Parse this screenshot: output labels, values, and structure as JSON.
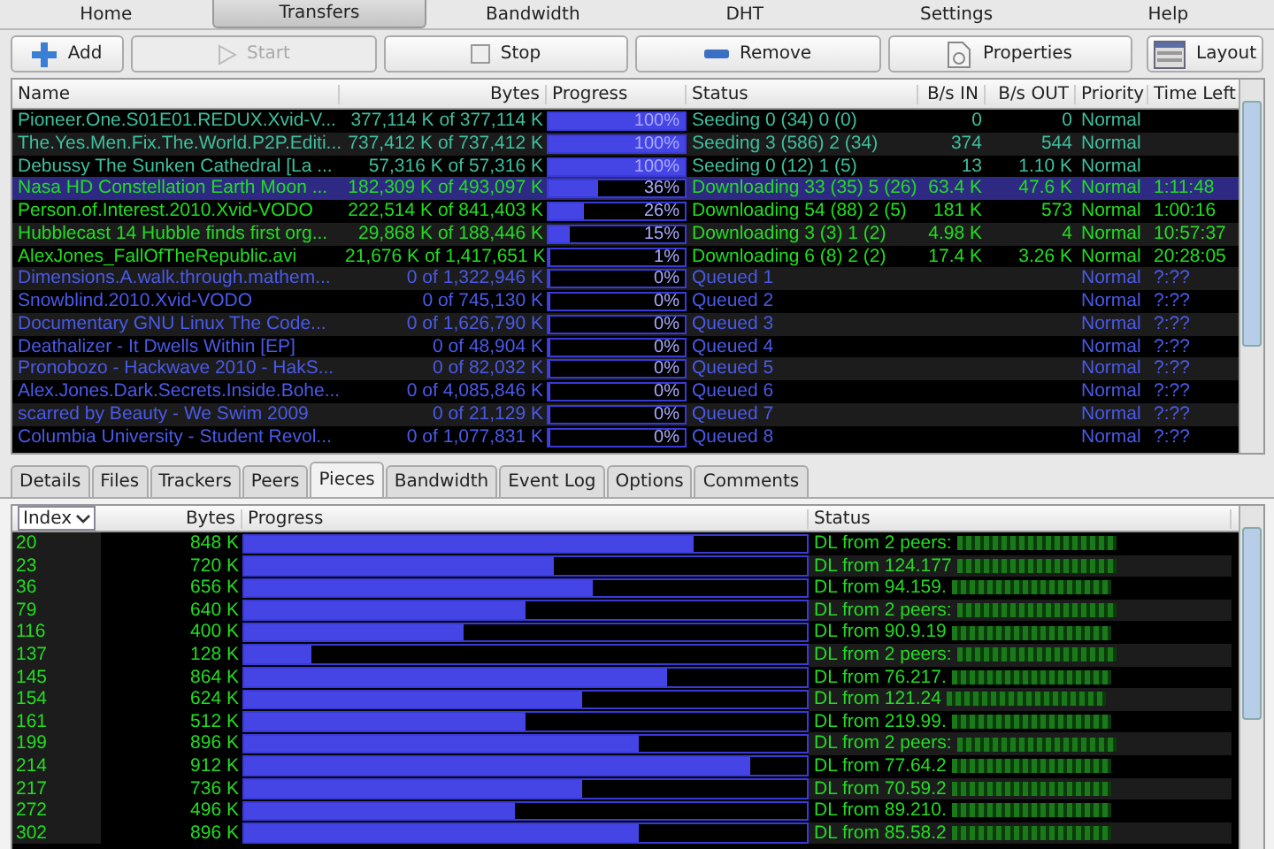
{
  "menu_tabs": [
    {
      "label": "Home",
      "selected": false
    },
    {
      "label": "Transfers",
      "selected": true
    },
    {
      "label": "Bandwidth",
      "selected": false
    },
    {
      "label": "DHT",
      "selected": false
    },
    {
      "label": "Settings",
      "selected": false
    },
    {
      "label": "Help",
      "selected": false
    }
  ],
  "toolbar": [
    {
      "kind": "add",
      "label": "Add",
      "disabled": false
    },
    {
      "kind": "start",
      "label": "Start",
      "disabled": true
    },
    {
      "kind": "stop",
      "label": "Stop",
      "disabled": false
    },
    {
      "kind": "remove",
      "label": "Remove",
      "disabled": false
    },
    {
      "kind": "properties",
      "label": "Properties",
      "disabled": false
    },
    {
      "kind": "layout",
      "label": "Layout",
      "disabled": false
    }
  ],
  "transfers": {
    "columns": [
      "Name",
      "Bytes",
      "Progress",
      "Status",
      "B/s IN",
      "B/s OUT",
      "Priority",
      "Time Left"
    ],
    "rows": [
      {
        "kind": "seeding",
        "selected": false,
        "name": "Pioneer.One.S01E01.REDUX.Xvid-V...",
        "bytes": "377,114 K of 377,114 K",
        "progress": "100%",
        "level": 1,
        "status": "Seeding 0 (34) 0 (0)",
        "in": "0",
        "out": "0",
        "priority": "Normal",
        "time_left": ""
      },
      {
        "kind": "seeding",
        "selected": false,
        "name": "The.Yes.Men.Fix.The.World.P2P.Editi...",
        "bytes": "737,412 K of 737,412 K",
        "progress": "100%",
        "level": 1,
        "status": "Seeding 3 (586) 2 (34)",
        "in": "374",
        "out": "544",
        "priority": "Normal",
        "time_left": ""
      },
      {
        "kind": "seeding",
        "selected": false,
        "name": "Debussy The Sunken Cathedral [La ...",
        "bytes": "57,316 K of 57,316 K",
        "progress": "100%",
        "level": 1,
        "status": "Seeding 0 (12) 1 (5)",
        "in": "13",
        "out": "1.10 K",
        "priority": "Normal",
        "time_left": ""
      },
      {
        "kind": "downloading",
        "selected": true,
        "name": "Nasa HD Constellation Earth Moon ...",
        "bytes": "182,309 K of 493,097 K",
        "progress": "36%",
        "level": 0.36,
        "status": "Downloading 33 (35) 5 (26)",
        "in": "63.4 K",
        "out": "47.6 K",
        "priority": "Normal",
        "time_left": "1:11:48"
      },
      {
        "kind": "downloading",
        "selected": false,
        "name": "Person.of.Interest.2010.Xvid-VODO",
        "bytes": "222,514 K of 841,403 K",
        "progress": "26%",
        "level": 0.26,
        "status": "Downloading 54 (88) 2 (5)",
        "in": "181 K",
        "out": "573",
        "priority": "Normal",
        "time_left": "1:00:16"
      },
      {
        "kind": "downloading",
        "selected": false,
        "name": "Hubblecast 14 Hubble finds first org...",
        "bytes": "29,868 K of 188,446 K",
        "progress": "15%",
        "level": 0.15,
        "status": "Downloading 3 (3) 1 (2)",
        "in": "4.98 K",
        "out": "4",
        "priority": "Normal",
        "time_left": "10:57:37"
      },
      {
        "kind": "downloading",
        "selected": false,
        "name": "AlexJones_FallOfTheRepublic.avi",
        "bytes": "21,676 K of 1,417,651 K",
        "progress": "1%",
        "level": 0.01,
        "status": "Downloading 6 (8) 2 (2)",
        "in": "17.4 K",
        "out": "3.26 K",
        "priority": "Normal",
        "time_left": "20:28:05"
      },
      {
        "kind": "queued",
        "selected": false,
        "name": "Dimensions.A.walk.through.mathem...",
        "bytes": "0 of 1,322,946 K",
        "progress": "0%",
        "level": 0,
        "status": "Queued 1",
        "in": "",
        "out": "",
        "priority": "Normal",
        "time_left": "?:??"
      },
      {
        "kind": "queued",
        "selected": false,
        "name": "Snowblind.2010.Xvid-VODO",
        "bytes": "0 of 745,130 K",
        "progress": "0%",
        "level": 0,
        "status": "Queued 2",
        "in": "",
        "out": "",
        "priority": "Normal",
        "time_left": "?:??"
      },
      {
        "kind": "queued",
        "selected": false,
        "name": "Documentary  GNU  Linux  The Code...",
        "bytes": "0 of 1,626,790 K",
        "progress": "0%",
        "level": 0,
        "status": "Queued 3",
        "in": "",
        "out": "",
        "priority": "Normal",
        "time_left": "?:??"
      },
      {
        "kind": "queued",
        "selected": false,
        "name": "Deathalizer - It Dwells Within [EP]",
        "bytes": "0 of 48,904 K",
        "progress": "0%",
        "level": 0,
        "status": "Queued 4",
        "in": "",
        "out": "",
        "priority": "Normal",
        "time_left": "?:??"
      },
      {
        "kind": "queued",
        "selected": false,
        "name": "Pronobozo - Hackwave 2010 - HakS...",
        "bytes": "0 of 82,032 K",
        "progress": "0%",
        "level": 0,
        "status": "Queued 5",
        "in": "",
        "out": "",
        "priority": "Normal",
        "time_left": "?:??"
      },
      {
        "kind": "queued",
        "selected": false,
        "name": "Alex.Jones.Dark.Secrets.Inside.Bohe...",
        "bytes": "0 of 4,085,846 K",
        "progress": "0%",
        "level": 0,
        "status": "Queued 6",
        "in": "",
        "out": "",
        "priority": "Normal",
        "time_left": "?:??"
      },
      {
        "kind": "queued",
        "selected": false,
        "name": "scarred by Beauty - We Swim 2009",
        "bytes": "0 of 21,129 K",
        "progress": "0%",
        "level": 0,
        "status": "Queued 7",
        "in": "",
        "out": "",
        "priority": "Normal",
        "time_left": "?:??"
      },
      {
        "kind": "queued",
        "selected": false,
        "name": "Columbia University - Student Revol...",
        "bytes": "0 of 1,077,831 K",
        "progress": "0%",
        "level": 0,
        "status": "Queued 8",
        "in": "",
        "out": "",
        "priority": "Normal",
        "time_left": "?:??"
      }
    ]
  },
  "detail_tabs": [
    {
      "label": "Details",
      "selected": false
    },
    {
      "label": "Files",
      "selected": false
    },
    {
      "label": "Trackers",
      "selected": false
    },
    {
      "label": "Peers",
      "selected": false
    },
    {
      "label": "Pieces",
      "selected": true
    },
    {
      "label": "Bandwidth",
      "selected": false
    },
    {
      "label": "Event Log",
      "selected": false
    },
    {
      "label": "Options",
      "selected": false
    },
    {
      "label": "Comments",
      "selected": false
    }
  ],
  "pieces": {
    "sort_select": "Index",
    "columns": [
      "Bytes",
      "Progress",
      "Status"
    ],
    "rows": [
      {
        "index": "20",
        "bytes": "848 K",
        "level": 0.8,
        "status": "DL from 2 peers:",
        "obscured": true
      },
      {
        "index": "23",
        "bytes": "720 K",
        "level": 0.55,
        "status": "DL from 124.177",
        "obscured": true
      },
      {
        "index": "36",
        "bytes": "656 K",
        "level": 0.62,
        "status": "DL from 94.159.",
        "obscured": true
      },
      {
        "index": "79",
        "bytes": "640 K",
        "level": 0.5,
        "status": "DL from 2 peers:",
        "obscured": true
      },
      {
        "index": "116",
        "bytes": "400 K",
        "level": 0.39,
        "status": "DL from 90.9.19",
        "obscured": true
      },
      {
        "index": "137",
        "bytes": "128 K",
        "level": 0.12,
        "status": "DL from 2 peers:",
        "obscured": true
      },
      {
        "index": "145",
        "bytes": "864 K",
        "level": 0.75,
        "status": "DL from 76.217.",
        "obscured": true
      },
      {
        "index": "154",
        "bytes": "624 K",
        "level": 0.6,
        "status": "DL from 121.24",
        "obscured": true
      },
      {
        "index": "161",
        "bytes": "512 K",
        "level": 0.5,
        "status": "DL from 219.99.",
        "obscured": true
      },
      {
        "index": "199",
        "bytes": "896 K",
        "level": 0.7,
        "status": "DL from 2 peers:",
        "obscured": true
      },
      {
        "index": "214",
        "bytes": "912 K",
        "level": 0.9,
        "status": "DL from 77.64.2",
        "obscured": true
      },
      {
        "index": "217",
        "bytes": "736 K",
        "level": 0.6,
        "status": "DL from 70.59.2",
        "obscured": true
      },
      {
        "index": "272",
        "bytes": "496 K",
        "level": 0.48,
        "status": "DL from 89.210.",
        "obscured": true
      },
      {
        "index": "302",
        "bytes": "896 K",
        "level": 0.7,
        "status": "DL from 85.58.2",
        "obscured": true
      }
    ]
  }
}
